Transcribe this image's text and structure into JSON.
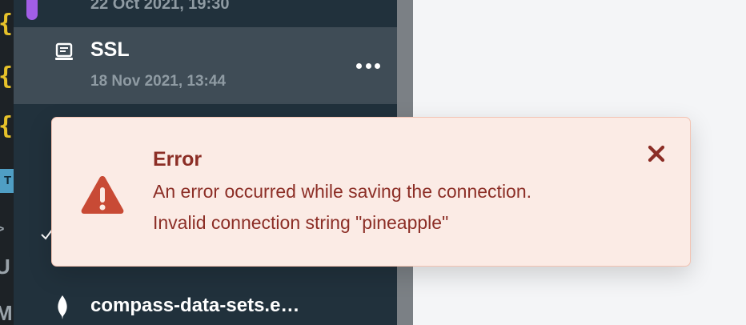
{
  "sidebar": {
    "previous_item": {
      "date": "22 Oct 2021, 19:30"
    },
    "active_item": {
      "title": "SSL",
      "date": "18 Nov 2021, 13:44",
      "icon": "connection-icon"
    },
    "bottom_item": {
      "title": "compass-data-sets.e…",
      "icon": "mongodb-leaf-icon"
    }
  },
  "code_strip": {
    "braces": [
      "{",
      "{",
      "{"
    ],
    "tag": "T",
    "glyphs": [
      ">",
      "U",
      "M"
    ]
  },
  "error_toast": {
    "title": "Error",
    "message": "An error occurred while saving the connection.",
    "detail": "Invalid connection string \"pineapple\"",
    "icon": "warning-icon",
    "close_icon": "close-icon"
  },
  "colors": {
    "sidebar_bg": "#21313c",
    "active_item_bg": "#3f4c56",
    "accent": "#a25ee6",
    "error_text": "#8c2e26",
    "error_icon": "#c84a35",
    "toast_bg": "#fbebe5"
  }
}
